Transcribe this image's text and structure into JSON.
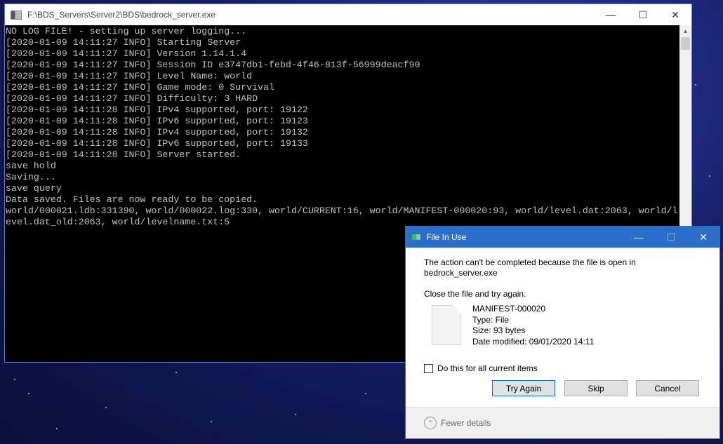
{
  "console": {
    "title": "F:\\BDS_Servers\\Server2\\BDS\\bedrock_server.exe",
    "lines": [
      "NO LOG FILE! - setting up server logging...",
      "[2020-01-09 14:11:27 INFO] Starting Server",
      "[2020-01-09 14:11:27 INFO] Version 1.14.1.4",
      "[2020-01-09 14:11:27 INFO] Session ID e3747db1-febd-4f46-813f-56999deacf90",
      "[2020-01-09 14:11:27 INFO] Level Name: world",
      "[2020-01-09 14:11:27 INFO] Game mode: 0 Survival",
      "[2020-01-09 14:11:27 INFO] Difficulty: 3 HARD",
      "[2020-01-09 14:11:28 INFO] IPv4 supported, port: 19122",
      "[2020-01-09 14:11:28 INFO] IPv6 supported, port: 19123",
      "[2020-01-09 14:11:28 INFO] IPv4 supported, port: 19132",
      "[2020-01-09 14:11:28 INFO] IPv6 supported, port: 19133",
      "[2020-01-09 14:11:28 INFO] Server started.",
      "save hold",
      "Saving...",
      "save query",
      "Data saved. Files are now ready to be copied.",
      "world/000021.ldb:331390, world/000022.log:330, world/CURRENT:16, world/MANIFEST-000020:93, world/level.dat:2063, world/l",
      "evel.dat_old:2063, world/levelname.txt:5"
    ]
  },
  "dialog": {
    "title": "File In Use",
    "message_line1": "The action can't be completed because the file is open in",
    "message_line2": "bedrock_server.exe",
    "instruction": "Close the file and try again.",
    "file_name": "MANIFEST-000020",
    "file_type": "Type: File",
    "file_size": "Size: 93 bytes",
    "file_date": "Date modified: 09/01/2020 14:11",
    "checkbox_label": "Do this for all current items",
    "checkbox_checked": false,
    "buttons": {
      "try_again": "Try Again",
      "skip": "Skip",
      "cancel": "Cancel"
    },
    "fewer_details": "Fewer details"
  },
  "colors": {
    "dialog_titlebar": "#2b6fcb",
    "console_bg": "#000000",
    "console_text": "#c0c0c0"
  }
}
